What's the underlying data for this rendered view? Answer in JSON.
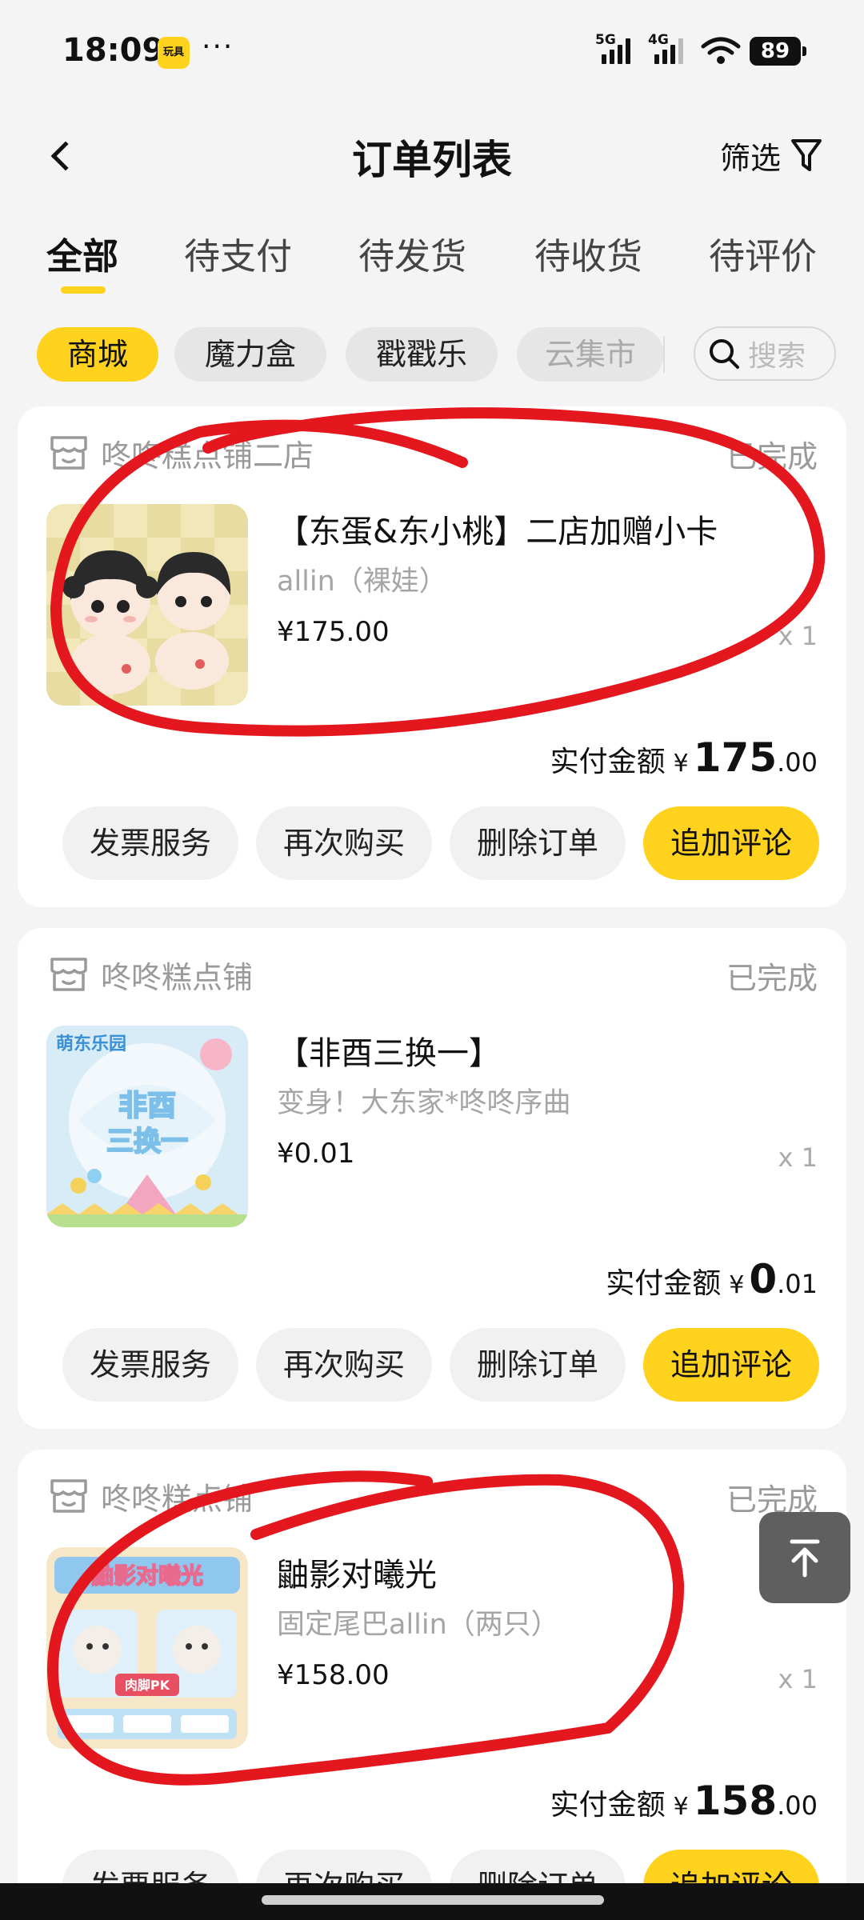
{
  "status_bar": {
    "time": "18:09",
    "app_icon_label": "玩具",
    "more": "···",
    "signal_1_label": "5G",
    "signal_2_label": "4G",
    "battery": "89"
  },
  "header": {
    "title": "订单列表",
    "filter_label": "筛选",
    "icons": {
      "back": "chevron-left-icon",
      "filter": "funnel-icon"
    }
  },
  "tabs": [
    "全部",
    "待支付",
    "待发货",
    "待收货",
    "待评价"
  ],
  "chips": {
    "items": [
      "商城",
      "魔力盒",
      "戳戳乐",
      "云集市"
    ],
    "search_placeholder": "搜索"
  },
  "orders": [
    {
      "shop": "咚咚糕点铺二店",
      "status": "已完成",
      "product_name": "【东蛋&东小桃】二店加赠小卡",
      "spec": "allin（裸娃）",
      "price": "¥175.00",
      "qty": "x 1",
      "paid_label": "实付金额",
      "paid_yen": "¥",
      "paid_int": "175",
      "paid_dec": ".00",
      "buttons": [
        "发票服务",
        "再次购买",
        "删除订单",
        "追加评论"
      ]
    },
    {
      "shop": "咚咚糕点铺",
      "status": "已完成",
      "product_name": "【非酉三换一】",
      "spec": "变身！大东家*咚咚序曲",
      "price": "¥0.01",
      "qty": "x 1",
      "paid_label": "实付金额",
      "paid_yen": "¥",
      "paid_int": "0",
      "paid_dec": ".01",
      "buttons": [
        "发票服务",
        "再次购买",
        "删除订单",
        "追加评论"
      ]
    },
    {
      "shop": "咚咚糕点铺",
      "status": "已完成",
      "product_name": "鼬影对曦光",
      "spec": "固定尾巴allin（两只）",
      "price": "¥158.00",
      "qty": "x 1",
      "paid_label": "实付金额",
      "paid_yen": "¥",
      "paid_int": "158",
      "paid_dec": ".00",
      "buttons": [
        "发票服务",
        "再次购买",
        "删除订单",
        "追加评论"
      ]
    }
  ],
  "thumb_texts": {
    "order2_a": "萌东乐园",
    "order2_b": "非酉",
    "order2_c": "三换一",
    "order3_banner": "鼬影对曦光",
    "order3_tag": "肉脚PK"
  },
  "colors": {
    "accent": "#ffd21e",
    "annotation": "#e4161e",
    "background": "#f4f4f4",
    "muted_text": "#9a9a9a"
  }
}
